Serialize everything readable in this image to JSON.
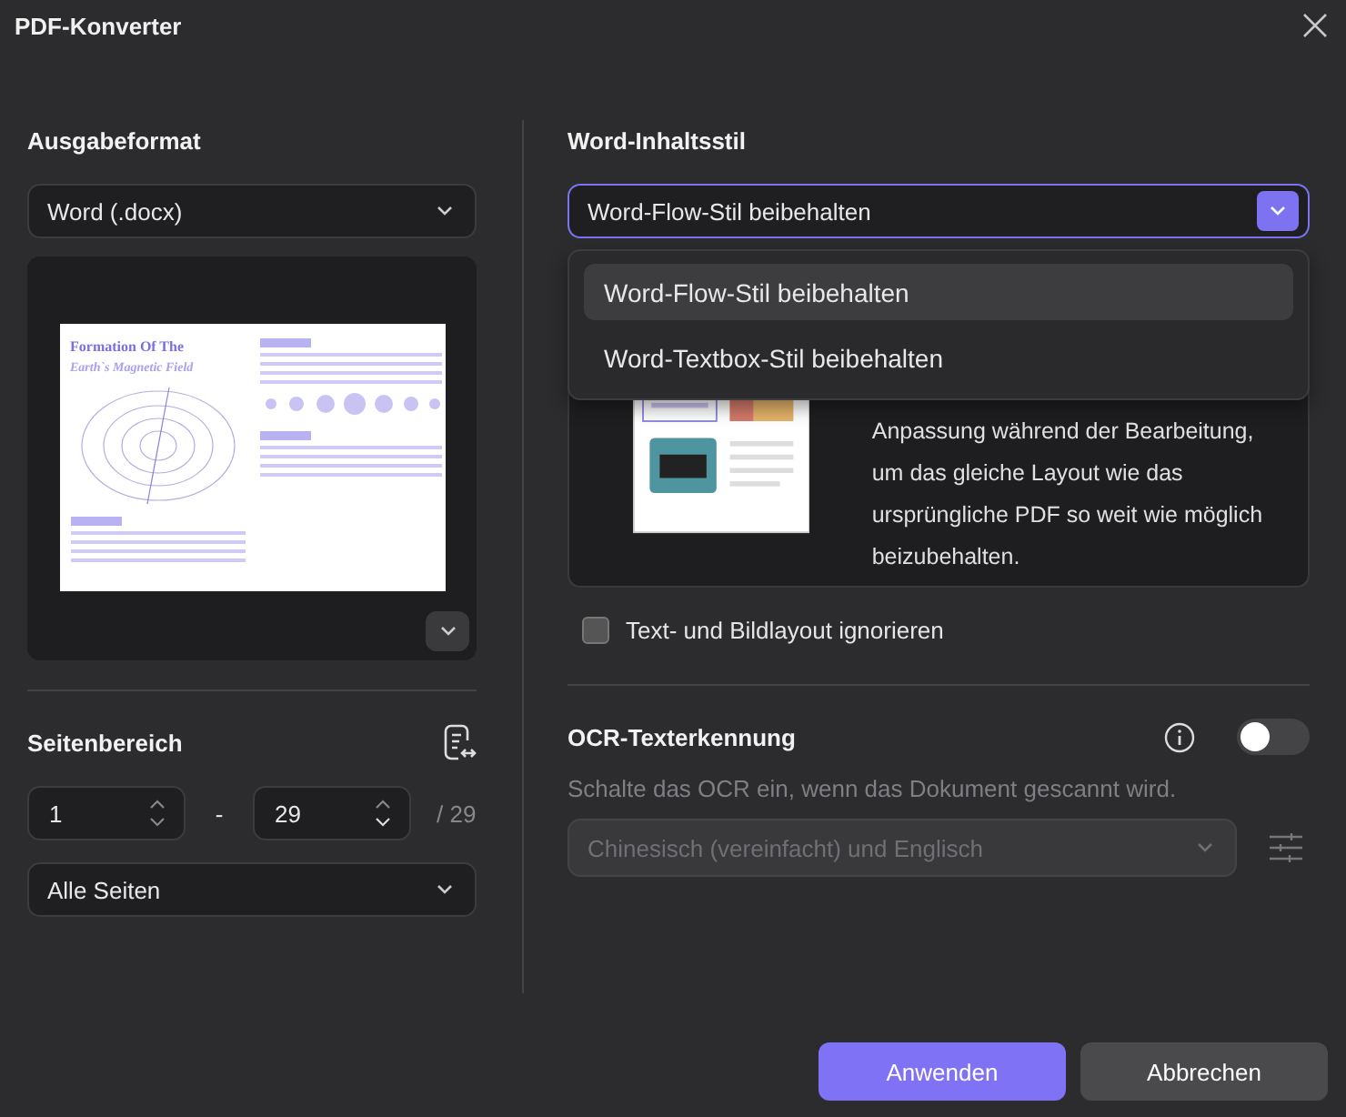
{
  "window": {
    "title": "PDF-Konverter"
  },
  "output_format": {
    "heading": "Ausgabeformat",
    "value": "Word (.docx)",
    "preview": {
      "title_line_1": "Formation Of The",
      "title_line_2": "Earth`s Magnetic Field"
    }
  },
  "page_range": {
    "heading": "Seitenbereich",
    "from": "1",
    "separator": "-",
    "to": "29",
    "total": "/ 29",
    "mode": "Alle Seiten"
  },
  "content_style": {
    "heading": "Word-Inhaltsstil",
    "value": "Word-Flow-Stil beibehalten",
    "expanded": true,
    "options": [
      {
        "label": "Word-Flow-Stil beibehalten",
        "selected": true
      },
      {
        "label": "Word-Textbox-Stil beibehalten",
        "selected": false
      }
    ],
    "description": "Anpassung während der Bearbeitung, um das gleiche Layout wie das ursprüngliche PDF so weit wie möglich beizubehalten.",
    "ignore_layout": {
      "label": "Text- und Bildlayout ignorieren",
      "checked": false
    }
  },
  "ocr": {
    "heading": "OCR-Texterkennung",
    "on": false,
    "hint": "Schalte das OCR ein, wenn das Dokument gescannt wird.",
    "language": "Chinesisch (vereinfacht) und Englisch",
    "disabled": true
  },
  "buttons": [
    {
      "label": "Anwenden",
      "kind": "primary"
    },
    {
      "label": "Abbrechen",
      "kind": "secondary"
    }
  ]
}
